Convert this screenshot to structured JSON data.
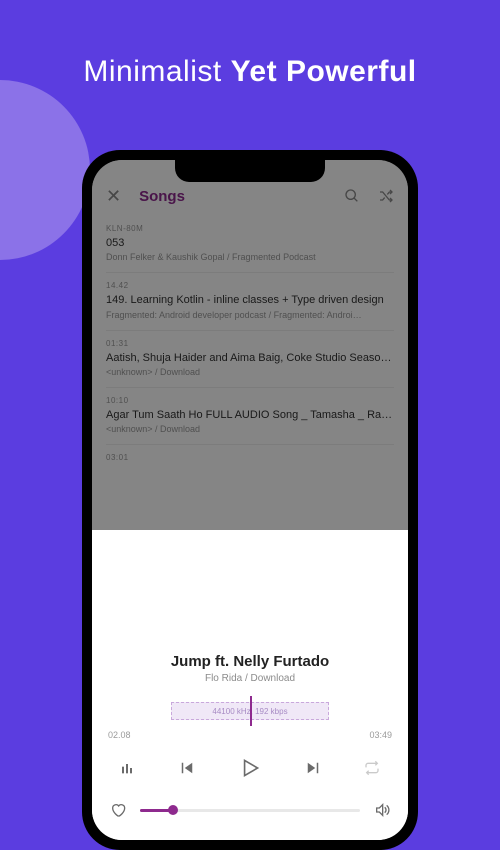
{
  "marketing": {
    "light": "Minimalist",
    "bold": "Yet Powerful"
  },
  "header": {
    "title": "Songs"
  },
  "songs": [
    {
      "index": "KLN-80M",
      "title": "053",
      "meta": "Donn Felker & Kaushik Gopal / Fragmented Podcast"
    },
    {
      "index": "14.42",
      "title": "149. Learning Kotlin - inline classes + Type driven design",
      "meta": "Fragmented: Android developer podcast / Fragmented: Androi…"
    },
    {
      "index": "01:31",
      "title": "Aatish, Shuja Haider and Aima Baig, Coke Studio Seaso…",
      "meta": "<unknown> / Download"
    },
    {
      "index": "10:10",
      "title": "Agar Tum Saath Ho FULL AUDIO Song _ Tamasha _ Ranb…",
      "meta": "<unknown> / Download"
    },
    {
      "index": "03:01",
      "title": "",
      "meta": ""
    }
  ],
  "nowPlaying": {
    "title": "Jump ft. Nelly Furtado",
    "meta": "Flo Rida / Download",
    "quality": "44100 kHz, 192 kbps",
    "currentTime": "02.08",
    "totalTime": "03:49"
  }
}
